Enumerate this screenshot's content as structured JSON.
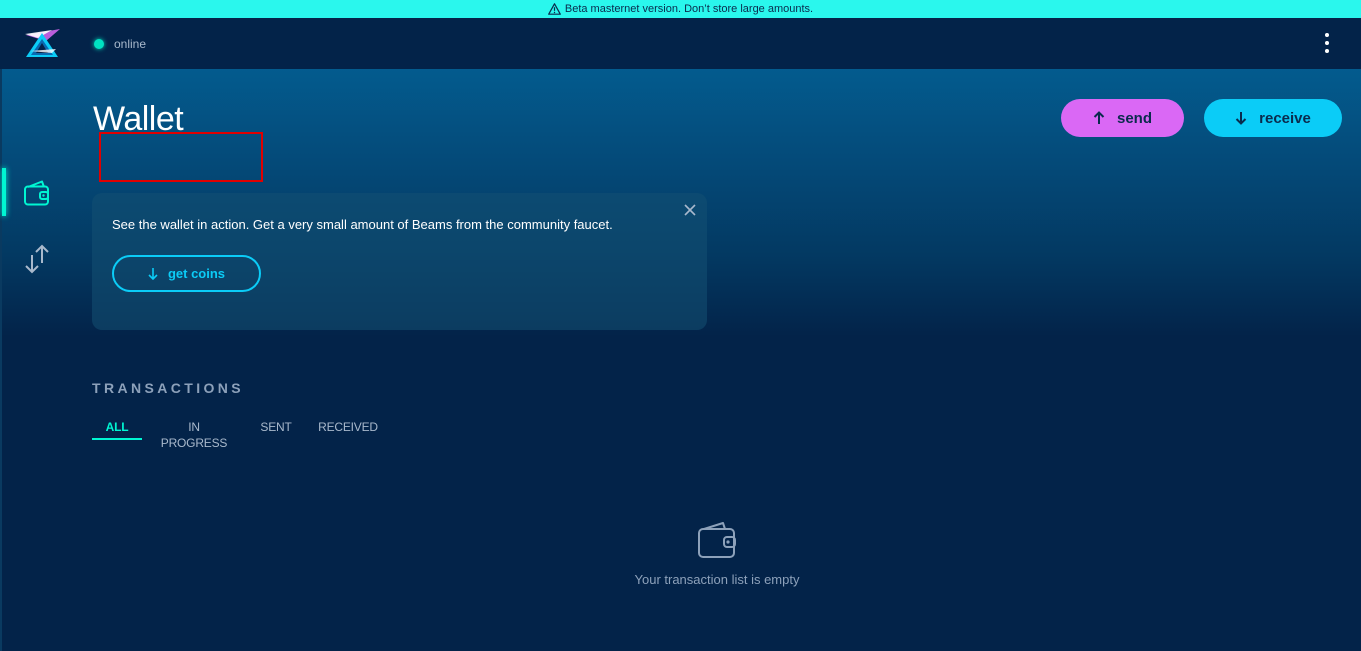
{
  "banner": {
    "text": "Beta masternet version. Don’t store large amounts."
  },
  "header": {
    "status": "online",
    "menu_icon": "more-vertical-icon",
    "logo": "beam-logo"
  },
  "sidebar": {
    "items": [
      {
        "name": "wallet",
        "icon": "wallet-icon",
        "active": true
      },
      {
        "name": "transactions",
        "icon": "transfer-arrows-icon",
        "active": false
      }
    ]
  },
  "main": {
    "title": "Wallet",
    "send_label": "send",
    "receive_label": "receive",
    "faucet": {
      "text": "See the wallet in action. Get a very small amount of Beams from the community faucet.",
      "button_label": "get coins"
    },
    "transactions": {
      "heading": "TRANSACTIONS",
      "tabs": [
        {
          "label": "ALL",
          "active": true
        },
        {
          "label": "IN PROGRESS",
          "active": false
        },
        {
          "label": "SENT",
          "active": false
        },
        {
          "label": "RECEIVED",
          "active": false
        }
      ],
      "empty_text": "Your transaction list is empty"
    }
  },
  "colors": {
    "accent_teal": "#00f6d2",
    "send": "#da68f5",
    "receive": "#0bccf7",
    "background": "#032349",
    "banner": "#2af7ed"
  }
}
